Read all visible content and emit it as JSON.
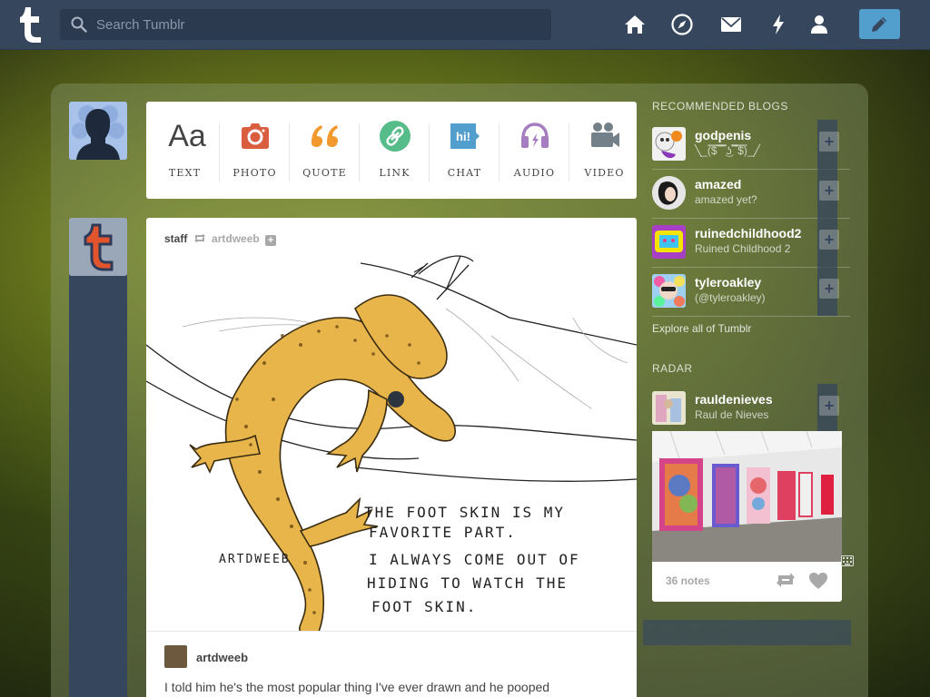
{
  "header": {
    "search_placeholder": "Search Tumblr",
    "nav": [
      "home-icon",
      "explore-icon",
      "inbox-icon",
      "activity-icon",
      "account-icon"
    ],
    "compose": "pencil-icon"
  },
  "post_types": [
    {
      "label": "TEXT",
      "icon": "text-icon",
      "color": "#444444"
    },
    {
      "label": "PHOTO",
      "icon": "photo-icon",
      "color": "#d95e40"
    },
    {
      "label": "QUOTE",
      "icon": "quote-icon",
      "color": "#f2992e"
    },
    {
      "label": "LINK",
      "icon": "link-icon",
      "color": "#56bc8a"
    },
    {
      "label": "CHAT",
      "icon": "chat-icon",
      "color": "#529ecc"
    },
    {
      "label": "AUDIO",
      "icon": "audio-icon",
      "color": "#a77dc2"
    },
    {
      "label": "VIDEO",
      "icon": "video-icon",
      "color": "#748089"
    }
  ],
  "post": {
    "poster": "staff",
    "reblogged_from": "artdweeb",
    "art_text": {
      "signature": "ARTDWEEB",
      "line1": "THE FOOT SKIN IS MY",
      "line2": "FAVORITE PART.",
      "line3": "I ALWAYS COME OUT OF",
      "line4": "HIDING TO WATCH THE",
      "line5": "FOOT SKIN."
    },
    "author": "artdweeb",
    "body": "I told him he's the most popular thing I've ever drawn and he pooped"
  },
  "sidebar": {
    "recommended_title": "RECOMMENDED BLOGS",
    "recommended": [
      {
        "name": "godpenis",
        "sub": "╲_(̿$̿ ̿ ̿̿ ͜ʖ ̿̿ ̿$̿)_╱"
      },
      {
        "name": "amazed",
        "sub": "amazed yet?"
      },
      {
        "name": "ruinedchildhood2",
        "sub": "Ruined Childhood 2"
      },
      {
        "name": "tyleroakley",
        "sub": "(@tyleroakley)"
      }
    ],
    "explore": "Explore all of Tumblr",
    "radar_title": "RADAR",
    "radar": {
      "name": "rauldenieves",
      "sub": "Raul de Nieves",
      "notes": "36 notes"
    }
  },
  "colors": {
    "header": "#36465d",
    "compose": "#529ecc"
  }
}
